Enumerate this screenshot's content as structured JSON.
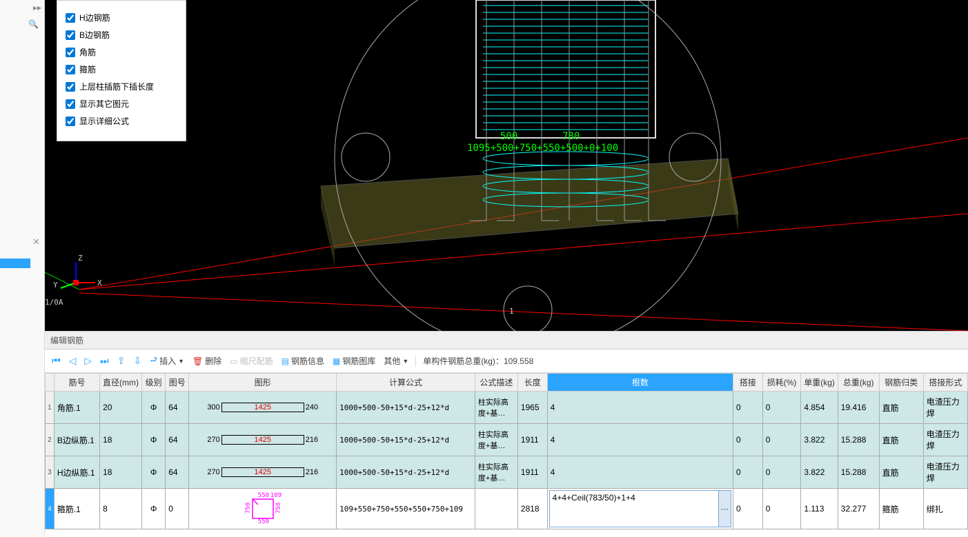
{
  "viewport": {
    "formula_overlay": "1095+500+750+550+500+0+100",
    "dim1": "500",
    "dim2": "780",
    "axis": {
      "x": "X",
      "y": "Y",
      "z": "Z"
    },
    "origin_label": "1/0A",
    "handle_label": "1"
  },
  "layer_popup": {
    "items": [
      {
        "label": "H边钢筋",
        "checked": true
      },
      {
        "label": "B边钢筋",
        "checked": true
      },
      {
        "label": "角筋",
        "checked": true
      },
      {
        "label": "箍筋",
        "checked": true
      },
      {
        "label": "上层柱插筋下插长度",
        "checked": true
      },
      {
        "label": "显示其它图元",
        "checked": true
      },
      {
        "label": "显示详细公式",
        "checked": true
      }
    ]
  },
  "grid": {
    "title": "编辑钢筋",
    "toolbar": {
      "insert": "插入",
      "delete": "删除",
      "scale": "缩尺配筋",
      "info": "钢筋信息",
      "lib": "钢筋图库",
      "other": "其他",
      "total_label": "单构件钢筋总重(kg)：",
      "total_value": "109.558"
    },
    "columns": {
      "no": "筋号",
      "dia": "直径(mm)",
      "lvl": "级别",
      "fig": "图号",
      "shape": "图形",
      "calc": "计算公式",
      "desc": "公式描述",
      "len": "长度",
      "qty": "根数",
      "lap": "搭接",
      "loss": "损耗(%)",
      "uw": "单重(kg)",
      "tw": "总重(kg)",
      "cat": "钢筋归类",
      "spl": "搭接形式"
    },
    "rows": [
      {
        "idx": "1",
        "no": "角筋.1",
        "dia": "20",
        "lvl": "Φ",
        "fig": "64",
        "shape": {
          "l": "300",
          "m": "1425",
          "r": "240"
        },
        "calc": "1000+500-50+15*d-25+12*d",
        "desc": "柱实际高度+基…",
        "len": "1965",
        "qty": "4",
        "lap": "0",
        "loss": "0",
        "uw": "4.854",
        "tw": "19.416",
        "cat": "直筋",
        "spl": "电渣压力焊"
      },
      {
        "idx": "2",
        "no": "B边纵筋.1",
        "dia": "18",
        "lvl": "Φ",
        "fig": "64",
        "shape": {
          "l": "270",
          "m": "1425",
          "r": "216"
        },
        "calc": "1000+500-50+15*d-25+12*d",
        "desc": "柱实际高度+基…",
        "len": "1911",
        "qty": "4",
        "lap": "0",
        "loss": "0",
        "uw": "3.822",
        "tw": "15.288",
        "cat": "直筋",
        "spl": "电渣压力焊"
      },
      {
        "idx": "3",
        "no": "H边纵筋.1",
        "dia": "18",
        "lvl": "Φ",
        "fig": "64",
        "shape": {
          "l": "270",
          "m": "1425",
          "r": "216"
        },
        "calc": "1000+500-50+15*d-25+12*d",
        "desc": "柱实际高度+基…",
        "len": "1911",
        "qty": "4",
        "lap": "0",
        "loss": "0",
        "uw": "3.822",
        "tw": "15.288",
        "cat": "直筋",
        "spl": "电渣压力焊"
      },
      {
        "idx": "4",
        "no": "箍筋.1",
        "dia": "8",
        "lvl": "Φ",
        "fig": "0",
        "shape_stirrup": {
          "t": "550",
          "b": "550",
          "l": "750",
          "r": "750",
          "hook": "109"
        },
        "calc": "109+550+750+550+550+750+109",
        "desc": "",
        "len": "2818",
        "qty_edit": "4+4+Ceil(783/50)+1+4",
        "lap": "0",
        "loss": "0",
        "uw": "1.113",
        "tw": "32.277",
        "cat": "箍筋",
        "spl": "绑扎"
      }
    ]
  }
}
